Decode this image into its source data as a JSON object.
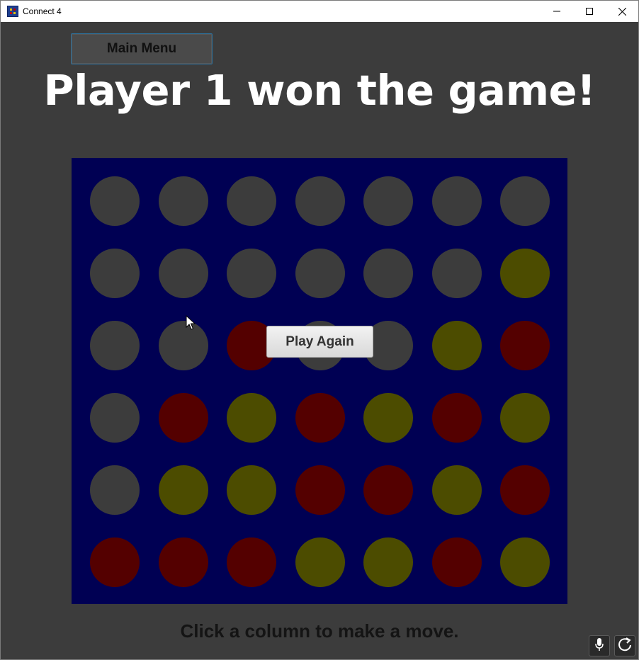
{
  "window": {
    "title": "Connect 4",
    "icon": "connect4-app-icon",
    "controls": [
      "minimize-icon",
      "maximize-icon",
      "close-icon"
    ]
  },
  "main_menu_label": "Main Menu",
  "headline": "Player 1 won the game!",
  "play_again_label": "Play Again",
  "status_text": "Click a column to make a move.",
  "colors": {
    "background": "#3c3c3c",
    "board": "#000053",
    "empty": "#3c3c3c",
    "red": "#540000",
    "yellow": "#4c4c00"
  },
  "board": {
    "columns": 7,
    "rows": 6,
    "grid": [
      [
        "E",
        "E",
        "E",
        "E",
        "E",
        "E",
        "E"
      ],
      [
        "E",
        "E",
        "E",
        "E",
        "E",
        "E",
        "Y"
      ],
      [
        "E",
        "E",
        "R",
        "E",
        "E",
        "Y",
        "R"
      ],
      [
        "E",
        "R",
        "Y",
        "R",
        "Y",
        "R",
        "Y"
      ],
      [
        "E",
        "Y",
        "Y",
        "R",
        "R",
        "Y",
        "R"
      ],
      [
        "R",
        "R",
        "R",
        "Y",
        "Y",
        "R",
        "Y"
      ]
    ]
  },
  "tray_icons": [
    "microphone-icon",
    "refresh-icon"
  ]
}
